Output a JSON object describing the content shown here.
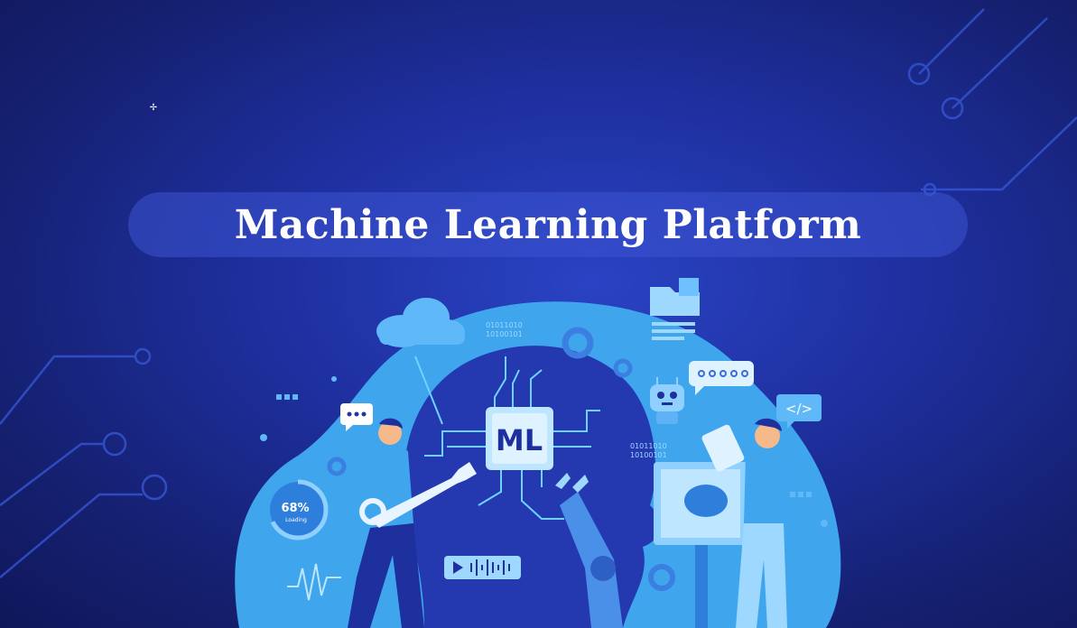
{
  "title": "Machine Learning Platform",
  "chip_label": "ML",
  "gauge": {
    "value": "68%",
    "caption": "Loading",
    "fraction": 0.68
  },
  "binary_top": [
    "01011010",
    "10100101"
  ],
  "binary_right": [
    "01011010",
    "10100101"
  ],
  "code_icon_label": "</>",
  "colors": {
    "background": "#1a2a8a",
    "banner": "#3c54d2",
    "cyan_blob": "#3fa6ee",
    "head": "#2235a8",
    "chip": "#bfe6ff",
    "accent": "#6fd3ff"
  },
  "icons": [
    "cloud-icon",
    "folder-icon",
    "gear-icon",
    "chat-bubble-icon",
    "robot-icon",
    "code-icon",
    "wrench-icon",
    "brain-icon",
    "tablet-icon",
    "audio-wave-icon",
    "play-icon"
  ]
}
